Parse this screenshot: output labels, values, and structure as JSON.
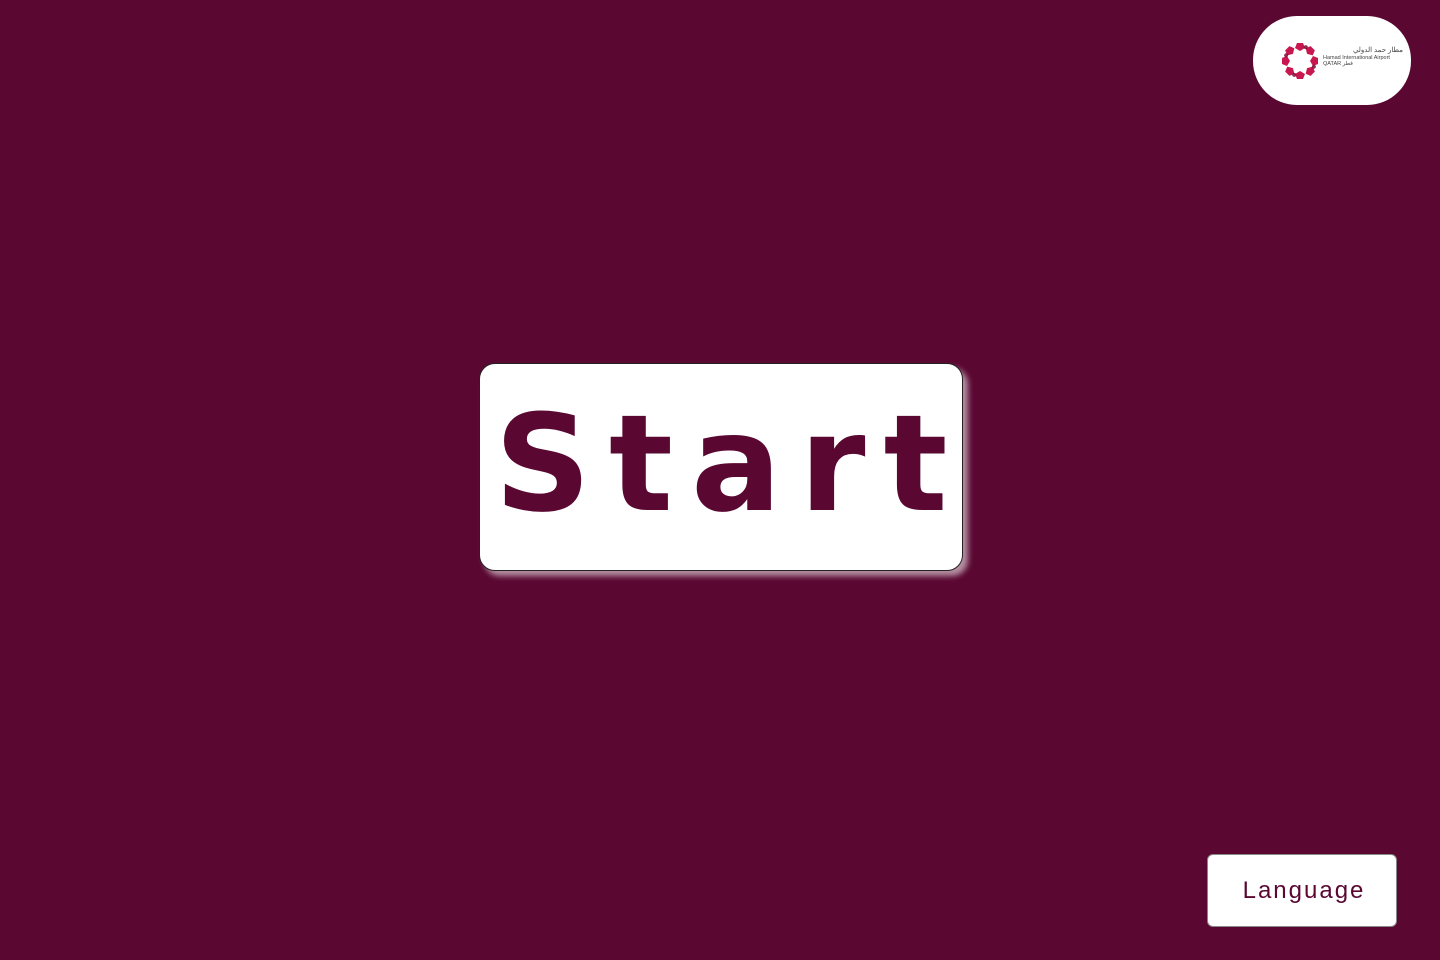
{
  "branding": {
    "logo_arabic": "مطار حمد الدولي",
    "logo_english": "Hamad International Airport",
    "logo_qatar": "QATAR قطر",
    "logo_icon": "hamad-airport-logo-mark",
    "accent_color": "#5a0832",
    "mark_color": "#c8174f"
  },
  "main": {
    "start_label": "Start"
  },
  "footer": {
    "language_label": "Language"
  }
}
